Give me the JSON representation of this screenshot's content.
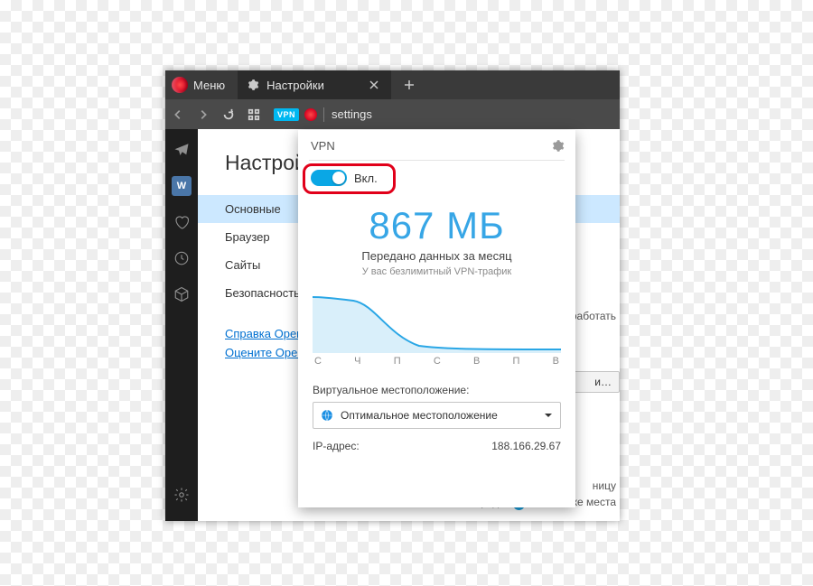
{
  "titlebar": {
    "menu": "Меню",
    "tab_label": "Настройки"
  },
  "addressbar": {
    "vpn_badge": "VPN",
    "text": "settings"
  },
  "page": {
    "title": "Настройки",
    "cat_active": "Основные",
    "cat_browser": "Браузер",
    "cat_sites": "Сайты",
    "cat_security": "Безопасность",
    "link_help": "Справка Opera",
    "link_rate": "Оцените Opera",
    "peek_work": "работать",
    "peek_btn": "и…",
    "peek_page": "ницу",
    "peek_continue": "Продолжить с того же места"
  },
  "vpn": {
    "title": "VPN",
    "toggle_label": "Вкл.",
    "amount": "867 МБ",
    "caption1": "Передано данных за месяц",
    "caption2": "У вас безлимитный VPN-трафик",
    "loc_title": "Виртуальное местоположение:",
    "loc_value": "Оптимальное местоположение",
    "ip_label": "IP-адрес:",
    "ip_value": "188.166.29.67"
  },
  "chart_data": {
    "type": "area",
    "categories": [
      "С",
      "Ч",
      "П",
      "С",
      "В",
      "П",
      "В"
    ],
    "values": [
      62,
      58,
      20,
      4,
      2,
      2,
      2
    ],
    "ylim": [
      0,
      70
    ],
    "title": "",
    "xlabel": "",
    "ylabel": ""
  }
}
